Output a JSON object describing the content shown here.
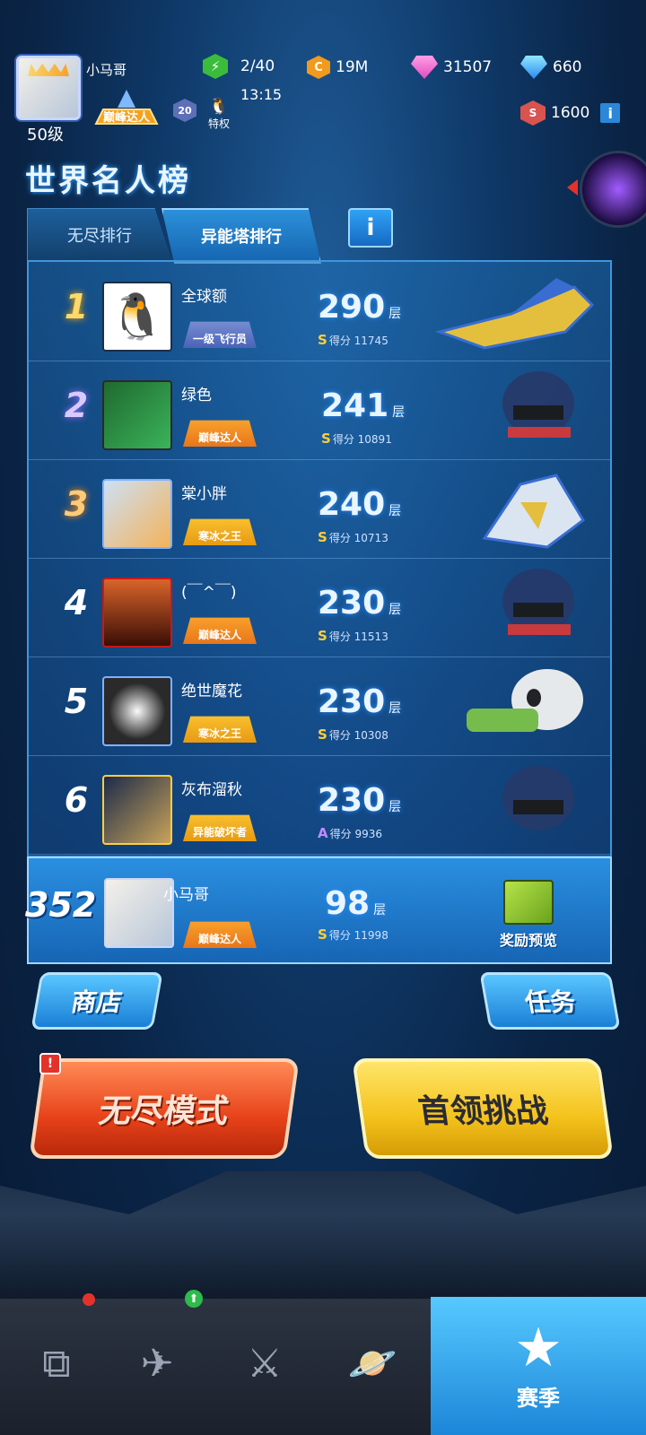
{
  "player": {
    "name": "小马哥",
    "level": "50级",
    "badge": "巅峰达人",
    "badge_level": "20",
    "privilege": "特权"
  },
  "resources": {
    "energy": "2/40",
    "energy_timer": "13:15",
    "coins": "19M",
    "pink_gems": "31507",
    "blue_gems": "660",
    "red_currency": "1600"
  },
  "page_title": "世界名人榜",
  "tabs": [
    {
      "label": "无尽排行",
      "active": false
    },
    {
      "label": "异能塔排行",
      "active": true
    }
  ],
  "ranking": [
    {
      "rank": "1",
      "name": "全球额",
      "badge": "一级飞行员",
      "floor": "290",
      "floor_unit": "层",
      "score_label": "得分",
      "score": "11745",
      "grade": "S"
    },
    {
      "rank": "2",
      "name": "绿色",
      "badge": "巅峰达人",
      "floor": "241",
      "floor_unit": "层",
      "score_label": "得分",
      "score": "10891",
      "grade": "S"
    },
    {
      "rank": "3",
      "name": "棠小胖",
      "badge": "寒冰之王",
      "floor": "240",
      "floor_unit": "层",
      "score_label": "得分",
      "score": "10713",
      "grade": "S"
    },
    {
      "rank": "4",
      "name": "(￣^￣)",
      "badge": "巅峰达人",
      "floor": "230",
      "floor_unit": "层",
      "score_label": "得分",
      "score": "11513",
      "grade": "S"
    },
    {
      "rank": "5",
      "name": "绝世魔花",
      "badge": "寒冰之王",
      "floor": "230",
      "floor_unit": "层",
      "score_label": "得分",
      "score": "10308",
      "grade": "S"
    },
    {
      "rank": "6",
      "name": "灰布溜秋",
      "badge": "异能破坏者",
      "floor": "230",
      "floor_unit": "层",
      "score_label": "得分",
      "score": "9936",
      "grade": "A"
    }
  ],
  "my_rank": {
    "rank": "352",
    "name": "小马哥",
    "badge": "巅峰达人",
    "floor": "98",
    "floor_unit": "层",
    "score_label": "得分",
    "score": "11998",
    "grade": "S",
    "reward_label": "奖励预览"
  },
  "buttons": {
    "shop": "商店",
    "tasks": "任务",
    "endless_mode": "无尽模式",
    "boss_challenge": "首领挑战",
    "alert": "!"
  },
  "nav": {
    "season_label": "赛季"
  },
  "icons": {
    "info": "i"
  },
  "colors": {
    "accent_blue": "#2b88d8",
    "endless_orange": "#e7421a",
    "boss_yellow": "#f4c21b"
  }
}
